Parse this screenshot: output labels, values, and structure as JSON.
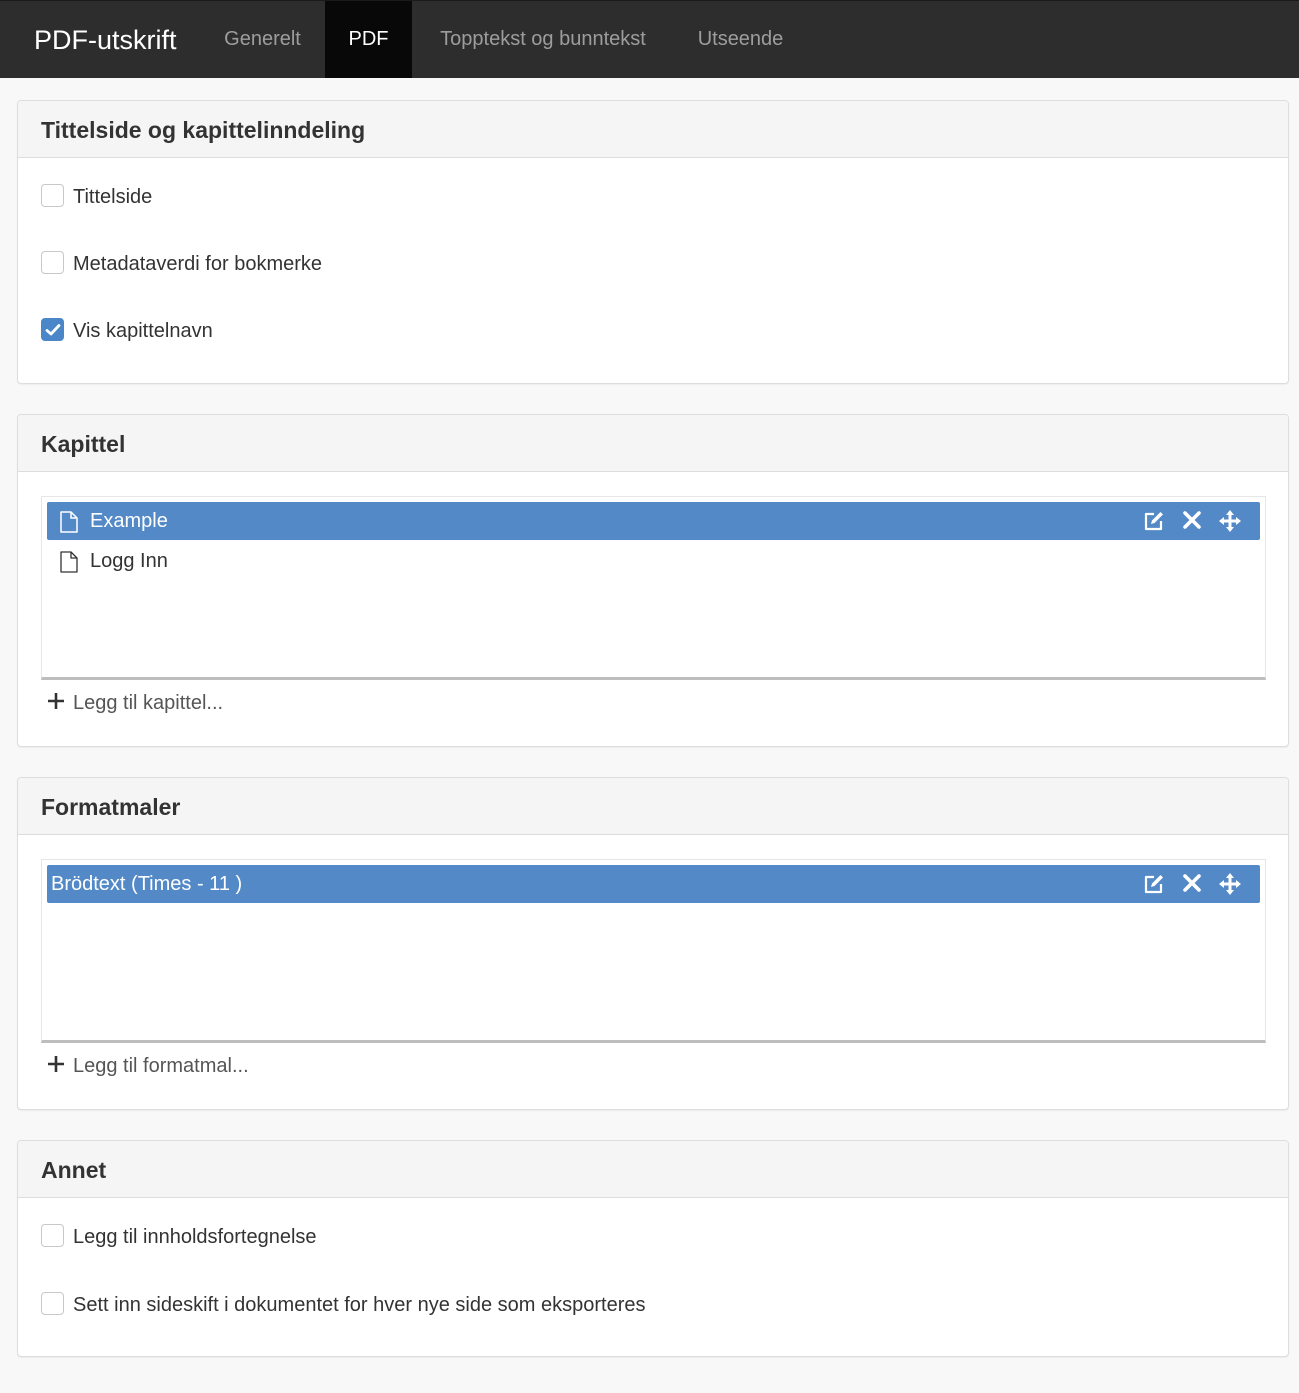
{
  "app": {
    "brand": "PDF-utskrift"
  },
  "nav": {
    "tabs": [
      {
        "label": "Generelt",
        "active": false
      },
      {
        "label": "PDF",
        "active": true
      },
      {
        "label": "Topptekst og bunntekst",
        "active": false
      },
      {
        "label": "Utseende",
        "active": false
      }
    ]
  },
  "title_section": {
    "heading": "Tittelside og kapittelinndeling",
    "options": [
      {
        "label": "Tittelside",
        "checked": false
      },
      {
        "label": "Metadataverdi for bokmerke",
        "checked": false
      },
      {
        "label": "Vis kapittelnavn",
        "checked": true
      }
    ]
  },
  "chapters": {
    "heading": "Kapittel",
    "items": [
      {
        "label": "Example",
        "selected": true,
        "icon": "document-icon"
      },
      {
        "label": "Logg Inn",
        "selected": false,
        "icon": "document-icon"
      }
    ],
    "add_label": "Legg til kapittel..."
  },
  "styles": {
    "heading": "Formatmaler",
    "items": [
      {
        "label": "Brödtext (Times - 11 )",
        "selected": true
      }
    ],
    "add_label": "Legg til formatmal..."
  },
  "other": {
    "heading": "Annet",
    "options": [
      {
        "label": "Legg til innholdsfortegnelse",
        "checked": false
      },
      {
        "label": "Sett inn sideskift i dokumentet for hver nye side som eksporteres",
        "checked": false
      }
    ]
  },
  "colors": {
    "navbar": "#2d2d2d",
    "active_tab": "#080808",
    "selection": "#5289c6",
    "checkbox_checked": "#4a86c8"
  }
}
